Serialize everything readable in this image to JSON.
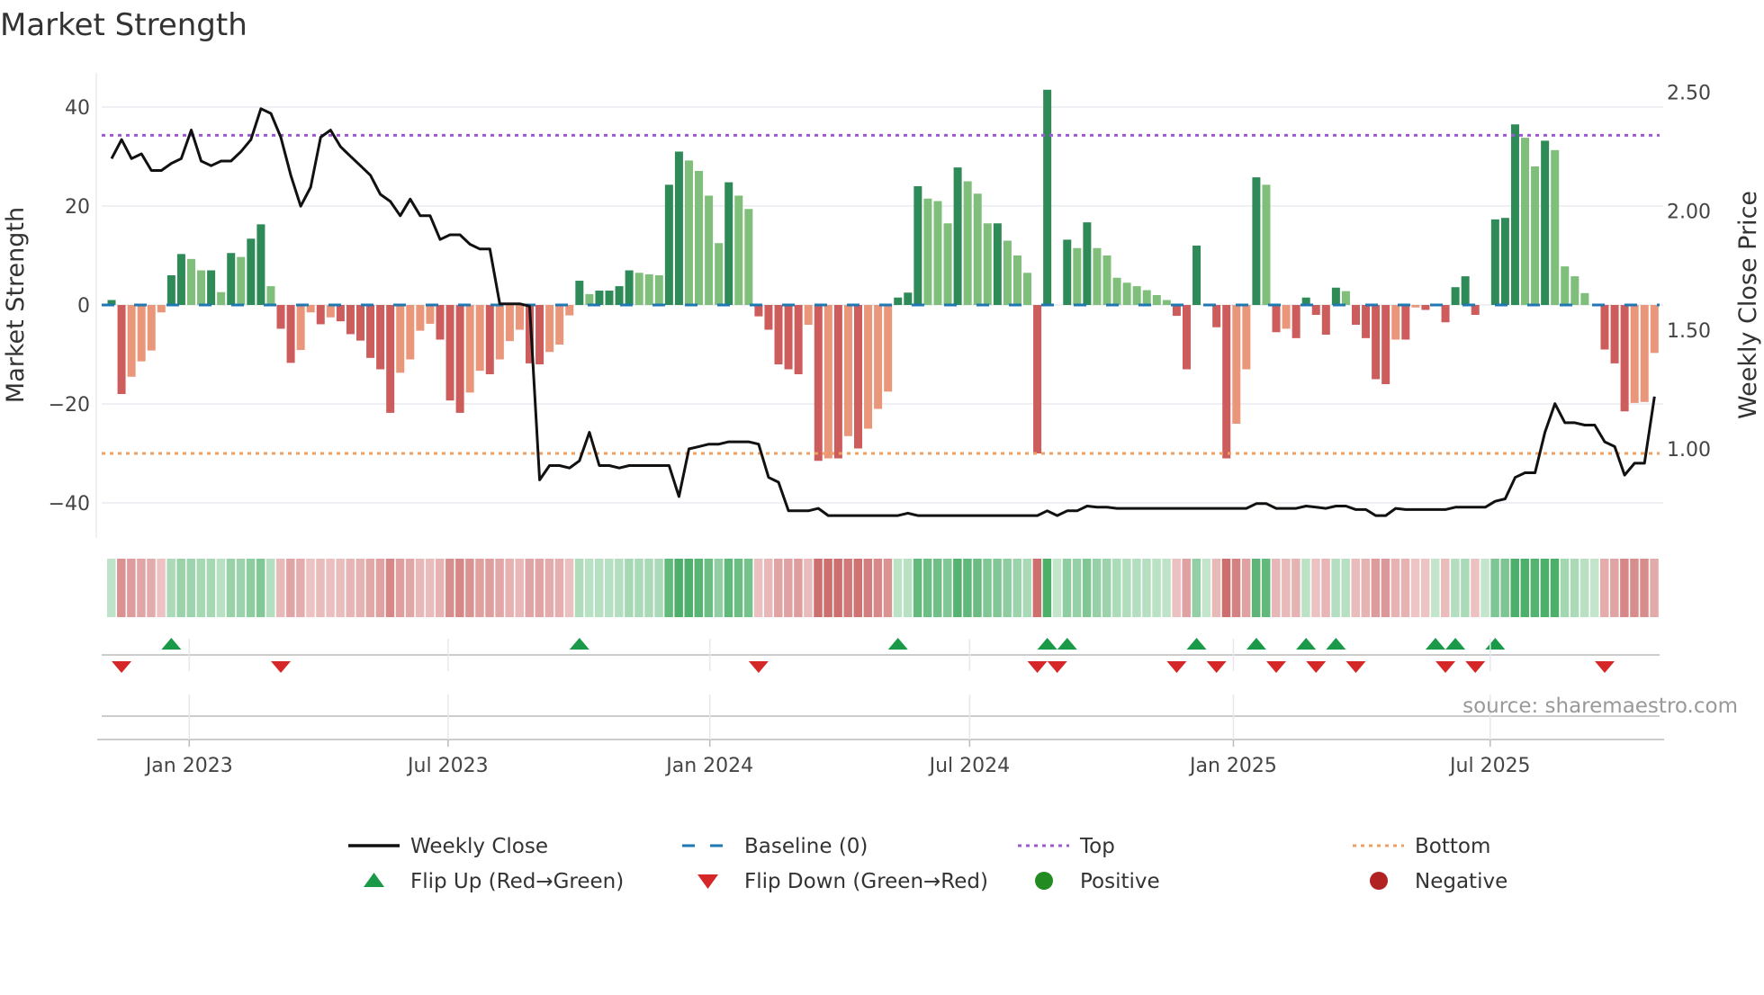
{
  "title": "Market Strength",
  "source": "source: sharemaestro.com",
  "colors": {
    "up_strong": "#2e8b57",
    "up_weak": "#7fbf7b",
    "down_strong": "#cd5c5c",
    "down_weak": "#e9967a",
    "top": "#9b59d6",
    "bottom": "#f0a060",
    "baseline": "#1f77b4",
    "flip_up": "#1a9a48",
    "flip_down": "#d62728",
    "positive": "#228b22",
    "negative": "#b22222"
  },
  "chart_data": {
    "type": "bar",
    "title": "Market Strength",
    "ylabel": "Market Strength",
    "y2label": "Weekly Close Price",
    "ylim": [
      -47,
      47
    ],
    "y2lim": [
      0.65,
      2.62
    ],
    "yticks": [
      40,
      20,
      0,
      -20,
      -40
    ],
    "yticklabels": [
      "40",
      "20",
      "0",
      "−20",
      "−40"
    ],
    "y2ticks": [
      2.5,
      2.0,
      1.5,
      1.0
    ],
    "y2ticklabels": [
      "2.50",
      "2.00",
      "1.50",
      "1.00"
    ],
    "x_unit": "week index",
    "xticks": [
      {
        "label": "Jan 2023",
        "week": 7.8
      },
      {
        "label": "Jul 2023",
        "week": 33.8
      },
      {
        "label": "Jan 2024",
        "week": 60.1
      },
      {
        "label": "Jul 2024",
        "week": 86.2
      },
      {
        "label": "Jan 2025",
        "week": 112.7
      },
      {
        "label": "Jul 2025",
        "week": 138.5
      }
    ],
    "top_level": 34.3,
    "bottom_level": -30,
    "baseline": 0,
    "strength": [
      1,
      -18,
      -14.5,
      -11.4,
      -9.2,
      -1.5,
      6,
      10.3,
      9.3,
      7,
      7,
      2.6,
      10.5,
      9.7,
      13.4,
      16.3,
      3.8,
      -4.8,
      -11.7,
      -9.1,
      -1.5,
      -3.9,
      -2.5,
      -3.3,
      -5.9,
      -7.2,
      -10.7,
      -13,
      -21.8,
      -13.7,
      -11,
      -5.2,
      -3.8,
      -7,
      -19.3,
      -21.8,
      -17.7,
      -13.3,
      -14,
      -11,
      -7.3,
      -5,
      -11.8,
      -12,
      -9.5,
      -8,
      -2.1,
      4.9,
      2.2,
      2.9,
      2.9,
      3.8,
      7,
      6.5,
      6.2,
      6,
      24.3,
      31,
      29.2,
      27.1,
      22.1,
      12.5,
      24.8,
      22.1,
      19.4,
      -2.3,
      -5,
      -12,
      -13,
      -14,
      -4,
      -31.5,
      -31,
      -31,
      -26.5,
      -29,
      -25,
      -21,
      -17.5,
      1.5,
      2.5,
      24,
      21.5,
      21,
      16.5,
      27.8,
      25,
      22.5,
      16.5,
      16.5,
      13,
      10,
      6.5,
      -30,
      43.5,
      0,
      13.2,
      11.5,
      16.7,
      11.5,
      10,
      5.5,
      4.5,
      3.8,
      3,
      2,
      1,
      -2.2,
      -13,
      12,
      0,
      -4.5,
      -31,
      -24,
      -13,
      25.8,
      24.3,
      -5.5,
      -4.8,
      -6.7,
      1.5,
      -2,
      -6,
      3.5,
      2.8,
      -4,
      -6.7,
      -15,
      -16,
      -7,
      -7,
      -0.5,
      -1,
      0,
      -3.5,
      3.6,
      5.8,
      -2,
      0,
      17.3,
      17.6,
      36.5,
      33.8,
      28,
      33.2,
      31.3,
      7.8,
      5.8,
      2.4,
      0,
      -9,
      -11.8,
      -21.5,
      -19.8,
      -19.6,
      -9.7
    ],
    "weekly_close": [
      2.22,
      2.3,
      2.22,
      2.24,
      2.17,
      2.17,
      2.2,
      2.22,
      2.34,
      2.21,
      2.19,
      2.21,
      2.21,
      2.25,
      2.3,
      2.43,
      2.41,
      2.31,
      2.15,
      2.02,
      2.1,
      2.31,
      2.34,
      2.27,
      2.23,
      2.19,
      2.15,
      2.07,
      2.04,
      1.98,
      2.05,
      1.98,
      1.98,
      1.88,
      1.9,
      1.9,
      1.86,
      1.84,
      1.84,
      1.61,
      1.61,
      1.61,
      1.6,
      0.87,
      0.93,
      0.93,
      0.92,
      0.95,
      1.07,
      0.93,
      0.93,
      0.92,
      0.93,
      0.93,
      0.93,
      0.93,
      0.93,
      0.8,
      1.0,
      1.01,
      1.02,
      1.02,
      1.03,
      1.03,
      1.03,
      1.02,
      0.88,
      0.86,
      0.74,
      0.74,
      0.74,
      0.75,
      0.72,
      0.72,
      0.72,
      0.72,
      0.72,
      0.72,
      0.72,
      0.72,
      0.73,
      0.72,
      0.72,
      0.72,
      0.72,
      0.72,
      0.72,
      0.72,
      0.72,
      0.72,
      0.72,
      0.72,
      0.72,
      0.72,
      0.74,
      0.72,
      0.74,
      0.74,
      0.76,
      0.755,
      0.755,
      0.75,
      0.75,
      0.75,
      0.75,
      0.75,
      0.75,
      0.75,
      0.75,
      0.75,
      0.75,
      0.75,
      0.75,
      0.75,
      0.75,
      0.77,
      0.77,
      0.75,
      0.75,
      0.75,
      0.76,
      0.755,
      0.75,
      0.76,
      0.76,
      0.745,
      0.745,
      0.72,
      0.72,
      0.75,
      0.745,
      0.745,
      0.745,
      0.745,
      0.745,
      0.755,
      0.755,
      0.755,
      0.755,
      0.78,
      0.79,
      0.88,
      0.9,
      0.9,
      1.07,
      1.19,
      1.11,
      1.11,
      1.1,
      1.1,
      1.03,
      1.01,
      0.89,
      0.94,
      0.94,
      1.22
    ],
    "flip_up_weeks": [
      6,
      47,
      79,
      94,
      96,
      109,
      115,
      120,
      123,
      133,
      135,
      139
    ],
    "flip_down_weeks": [
      1,
      17,
      65,
      93,
      95,
      107,
      111,
      117,
      121,
      125,
      134,
      137,
      150
    ],
    "legend": {
      "placement": "bottom",
      "items": [
        {
          "key": "close",
          "label": "Weekly Close"
        },
        {
          "key": "baseline",
          "label": "Baseline (0)"
        },
        {
          "key": "top",
          "label": "Top"
        },
        {
          "key": "bottom",
          "label": "Bottom"
        },
        {
          "key": "flip_up",
          "label": "Flip Up (Red→Green)"
        },
        {
          "key": "flip_down",
          "label": "Flip Down (Green→Red)"
        },
        {
          "key": "positive",
          "label": "Positive"
        },
        {
          "key": "negative",
          "label": "Negative"
        }
      ]
    }
  }
}
